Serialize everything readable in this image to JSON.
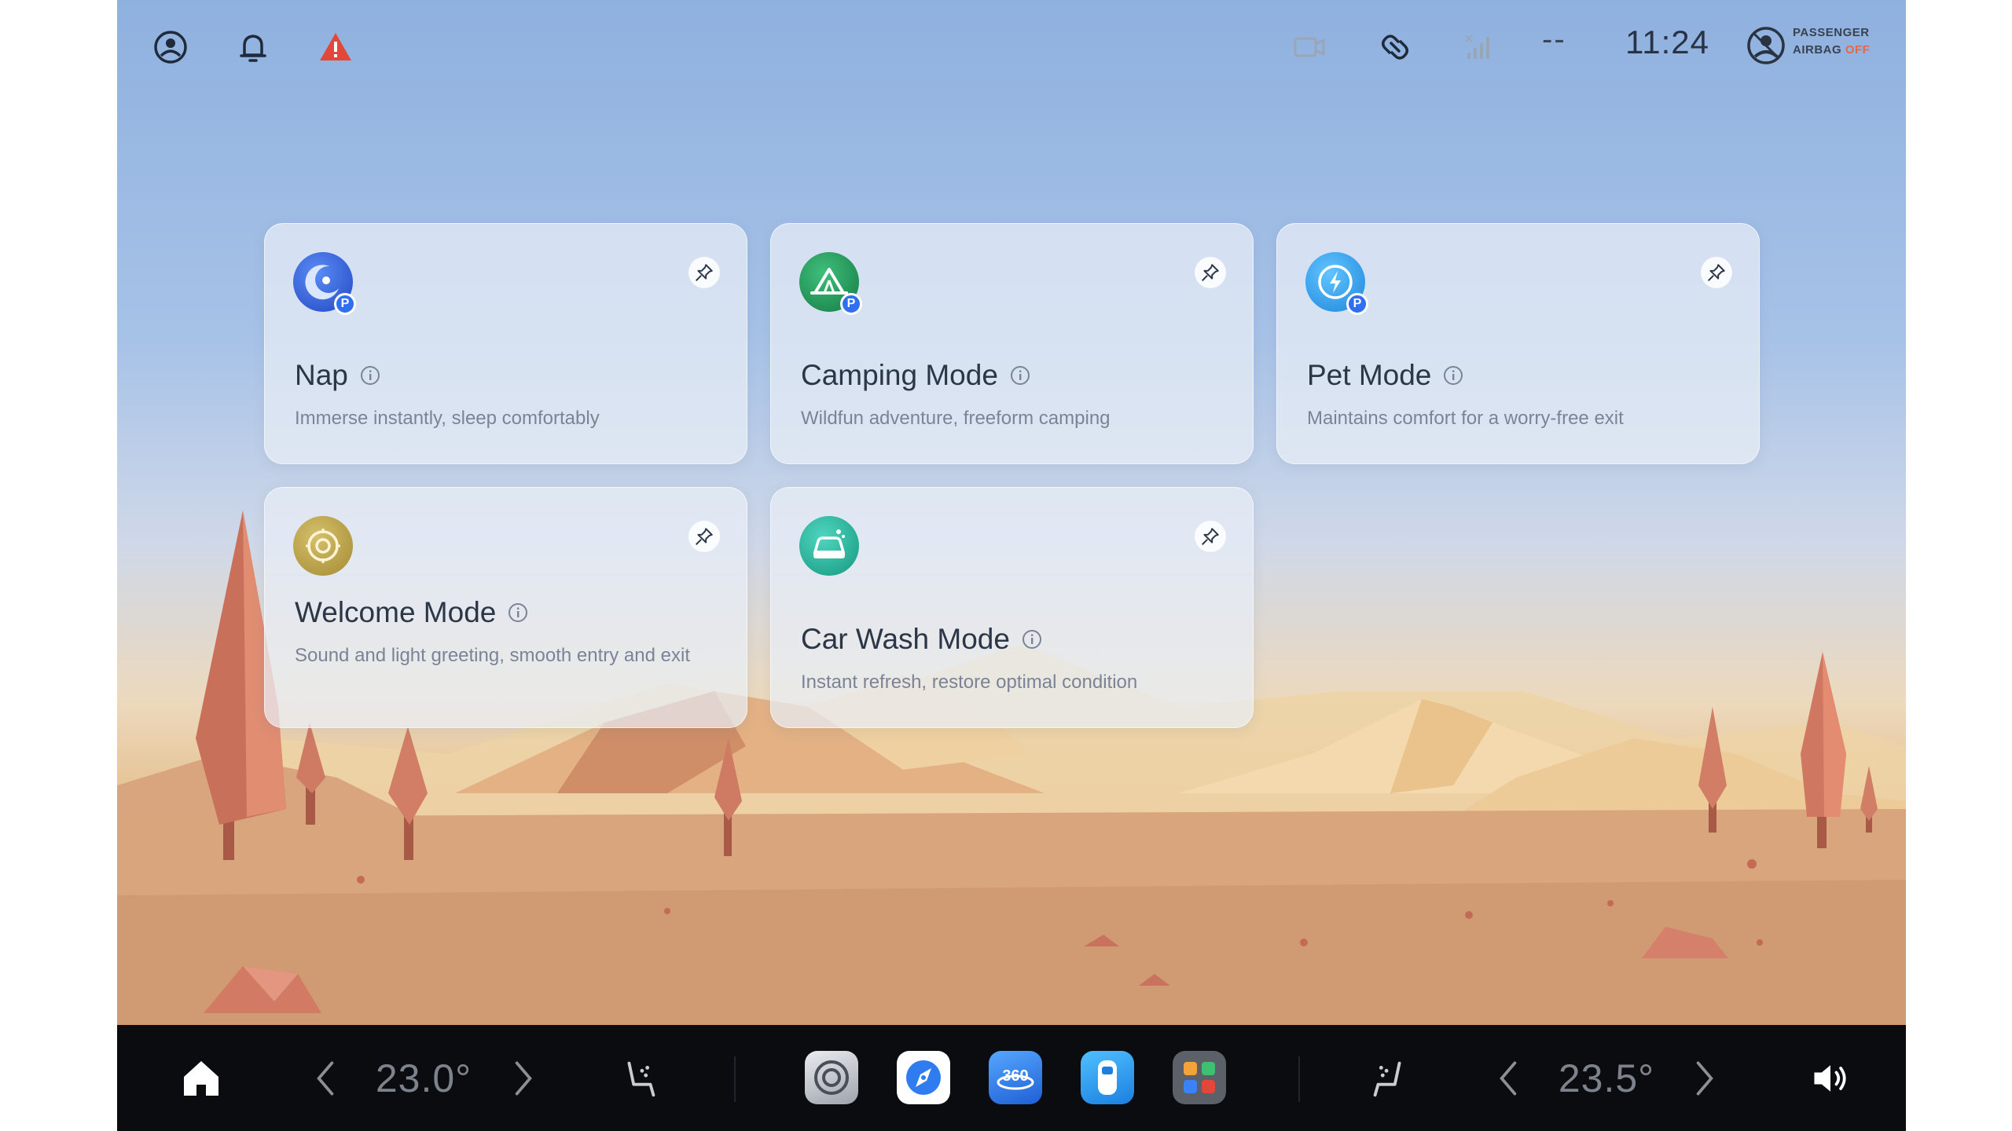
{
  "status_bar": {
    "left_icons": [
      "profile-circle-icon",
      "bell-icon",
      "warning-triangle-icon"
    ],
    "right_icons": [
      "dashcam-icon",
      "connection-icon",
      "signal-icon"
    ],
    "signal_text": "--",
    "time": "11:24",
    "airbag_line1": "PASSENGER",
    "airbag_line2": "AIRBAG",
    "airbag_state": "OFF"
  },
  "cards": [
    {
      "title": "Nap",
      "subtitle": "Immerse instantly, sleep comfortably",
      "icon": "moon-icon",
      "icon_color": "#2d5fd8",
      "badge": "P"
    },
    {
      "title": "Camping Mode",
      "subtitle": "Wildfun adventure, freeform camping",
      "icon": "tent-icon",
      "icon_color": "#1f8f55",
      "badge": "P"
    },
    {
      "title": "Pet Mode",
      "subtitle": "Maintains comfort for a worry-free exit",
      "icon": "bolt-icon",
      "icon_color": "#2b9be8",
      "badge": "P"
    },
    {
      "title": "Welcome Mode",
      "subtitle": "Sound and light greeting, smooth entry and exit",
      "icon": "welcome-icon",
      "icon_color": "#b8a04a"
    },
    {
      "title": "Car Wash Mode",
      "subtitle": "Instant refresh, restore optimal condition",
      "icon": "car-wash-icon",
      "icon_color": "#1fae9a"
    }
  ],
  "dock": {
    "left_temp": "23.0°",
    "right_temp": "23.5°",
    "apps": [
      "settings-app-icon",
      "navigation-app-icon",
      "camera-360-app-icon",
      "vehicle-app-icon",
      "app-launcher-icon"
    ],
    "app_360_label": "360"
  },
  "colors": {
    "accent_blue": "#2f6ff0",
    "warning_red": "#e2483a",
    "dock_bg": "#0b0c0f"
  }
}
